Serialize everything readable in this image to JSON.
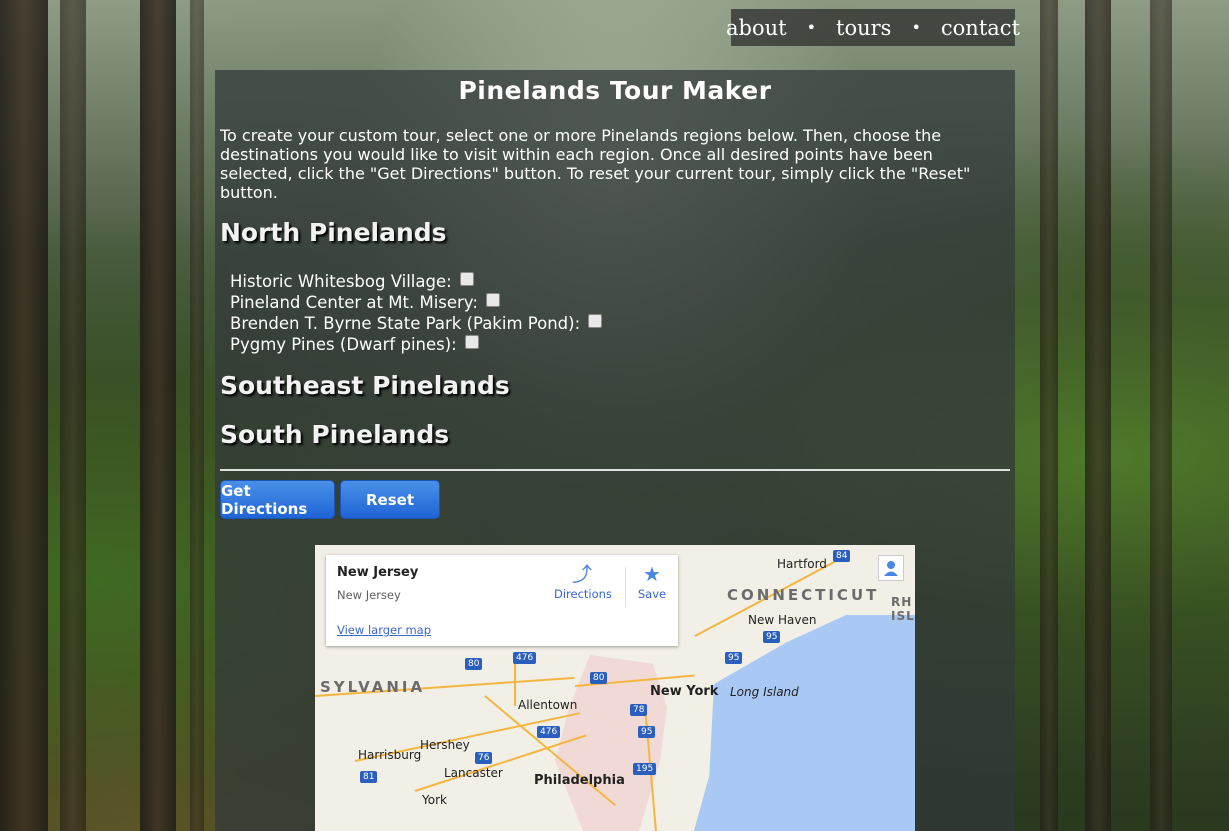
{
  "nav": {
    "items": [
      "about",
      "tours",
      "contact"
    ],
    "separator": "•"
  },
  "page": {
    "title": "Pinelands Tour Maker",
    "intro": "To create your custom tour, select one or more Pinelands regions below. Then, choose the destinations you would like to visit within each region. Once all desired points have been selected, click the \"Get Directions\" button. To reset your current tour, simply click the \"Reset\" button."
  },
  "sections": {
    "north": "North Pinelands",
    "southeast": "Southeast Pinelands",
    "south": "South Pinelands"
  },
  "north_options": [
    {
      "label": "Historic Whitesbog Village:",
      "checked": false
    },
    {
      "label": "Pineland Center at Mt. Misery:",
      "checked": false
    },
    {
      "label": "Brenden T. Byrne State Park (Pakim Pond):",
      "checked": false
    },
    {
      "label": "Pygmy Pines (Dwarf pines):",
      "checked": false
    }
  ],
  "buttons": {
    "directions": "Get Directions",
    "reset": "Reset"
  },
  "map": {
    "place_name": "New Jersey",
    "place_address": "New Jersey",
    "view_larger": "View larger map",
    "directions": "Directions",
    "save": "Save",
    "states": [
      "CONNECTICUT",
      "SYLVANIA",
      "RH ISL"
    ],
    "cities": {
      "hartford": "Hartford",
      "new_haven": "New Haven",
      "new_york": "New York",
      "long_island": "Long Island",
      "allentown": "Allentown",
      "hershey": "Hershey",
      "harrisburg": "Harrisburg",
      "lancaster": "Lancaster",
      "philadelphia": "Philadelphia",
      "york": "York"
    },
    "shields": [
      "84",
      "95",
      "80",
      "476",
      "80",
      "78",
      "95",
      "476",
      "76",
      "195",
      "81",
      "95"
    ]
  }
}
